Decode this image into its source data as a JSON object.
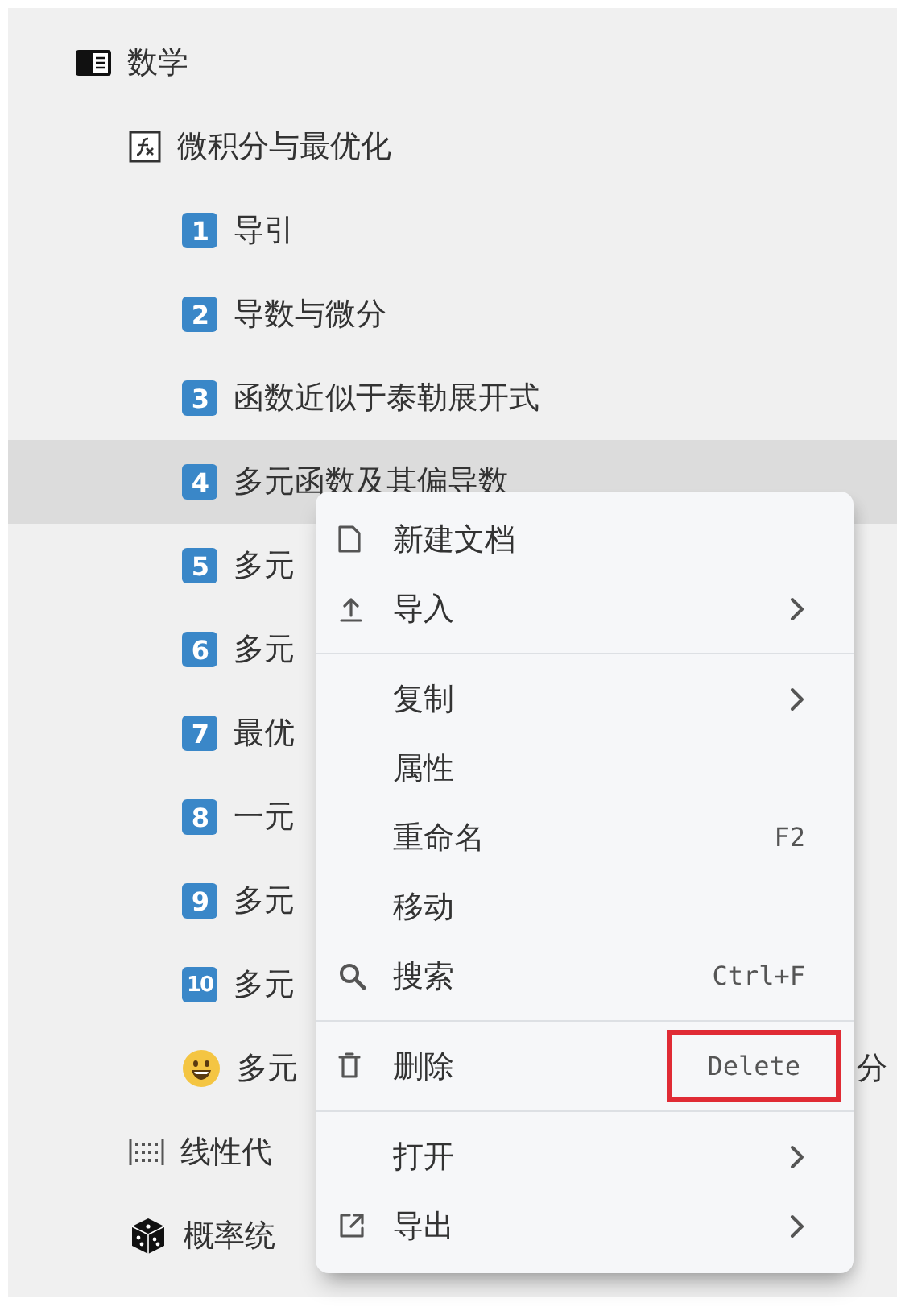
{
  "tree": [
    {
      "label": "数学",
      "kind": "book",
      "children": [
        {
          "label": "微积分与最优化",
          "kind": "function",
          "children": [
            {
              "label": "导引",
              "kind": "numbered",
              "badge": "1",
              "selected": false
            },
            {
              "label": "导数与微分",
              "kind": "numbered",
              "badge": "2",
              "selected": false
            },
            {
              "label": "函数近似于泰勒展开式",
              "kind": "numbered",
              "badge": "3",
              "selected": false
            },
            {
              "label": "多元函数及其偏导数",
              "kind": "numbered",
              "badge": "4",
              "selected": true
            },
            {
              "label": "多元",
              "kind": "numbered",
              "badge": "5",
              "selected": false
            },
            {
              "label": "多元",
              "kind": "numbered",
              "badge": "6",
              "selected": false
            },
            {
              "label": "最优",
              "kind": "numbered",
              "badge": "7",
              "selected": false
            },
            {
              "label": "一元",
              "kind": "numbered",
              "badge": "8",
              "selected": false
            },
            {
              "label": "多元",
              "kind": "numbered",
              "badge": "9",
              "selected": false
            },
            {
              "label": "多元",
              "kind": "numbered",
              "badge": "10",
              "selected": false
            },
            {
              "label": "多元",
              "kind": "emoji",
              "tail": "分",
              "selected": false
            }
          ]
        },
        {
          "label": "线性代",
          "kind": "grid"
        },
        {
          "label": "概率统",
          "kind": "dice"
        }
      ]
    }
  ],
  "menu": [
    {
      "label": "新建文档"
    },
    {
      "label": "导入",
      "submenu": true
    },
    {
      "kind": "separator"
    },
    {
      "label": "复制",
      "submenu": true
    },
    {
      "label": "属性"
    },
    {
      "label": "重命名",
      "shortcut": "F2"
    },
    {
      "label": "移动"
    },
    {
      "label": "搜索",
      "shortcut": "Ctrl+F"
    },
    {
      "kind": "separator"
    },
    {
      "label": "删除",
      "shortcut": "Delete",
      "highlighted": true
    },
    {
      "kind": "separator"
    },
    {
      "label": "打开",
      "submenu": true
    },
    {
      "label": "导出",
      "submenu": true
    }
  ]
}
